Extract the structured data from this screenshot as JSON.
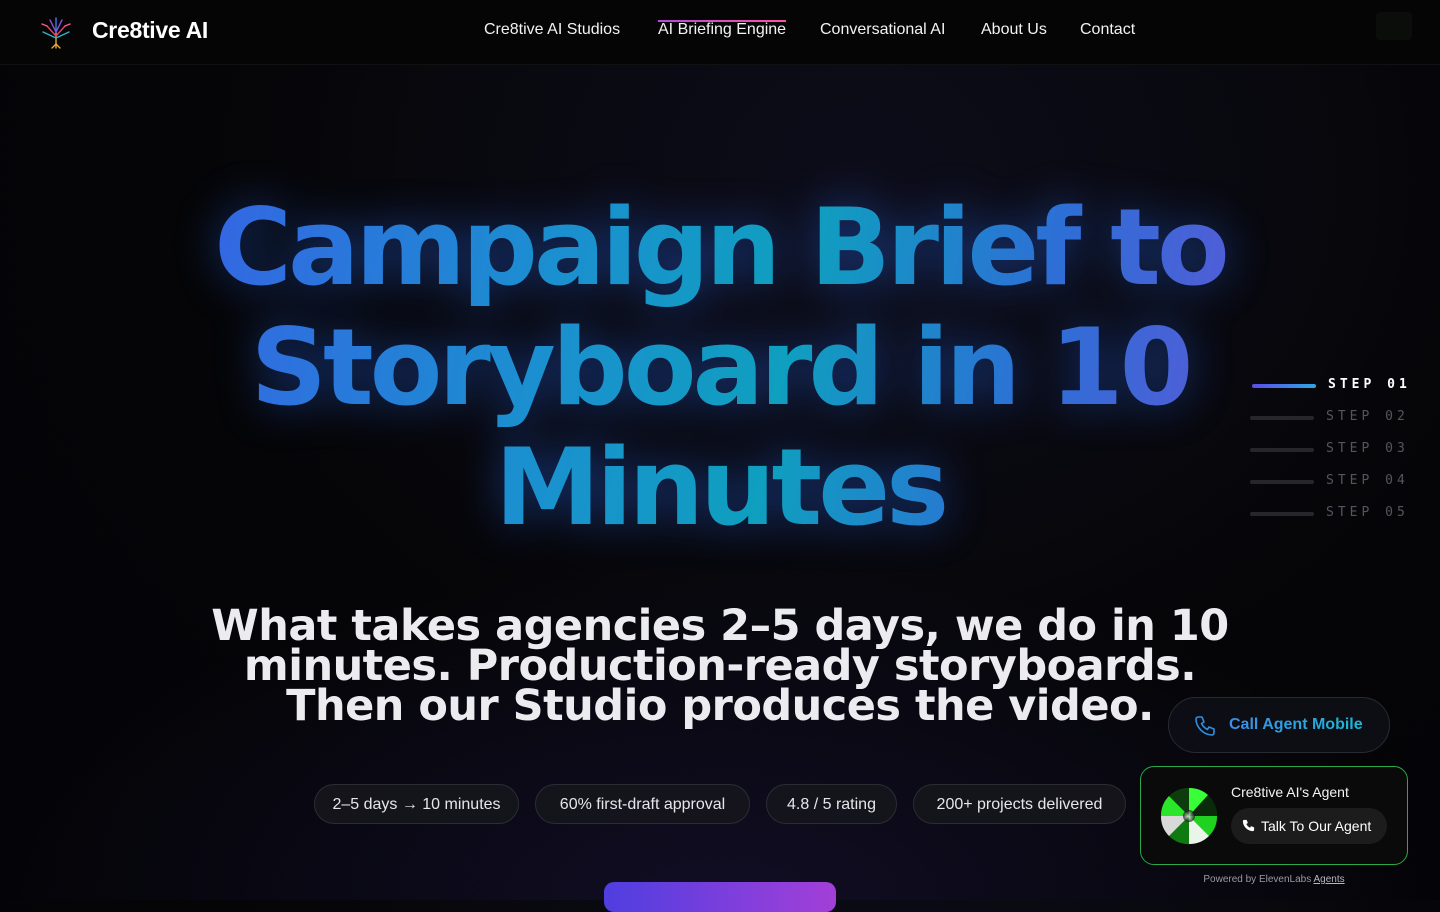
{
  "brand": {
    "name": "Cre8tive AI",
    "logo_icon": "tree-logo-icon"
  },
  "nav": {
    "items": [
      {
        "label": "Cre8tive AI Studios",
        "active": false
      },
      {
        "label": "AI Briefing Engine",
        "active": true
      },
      {
        "label": "Conversational AI",
        "active": false
      },
      {
        "label": "About Us",
        "active": false
      },
      {
        "label": "Contact",
        "active": false
      }
    ],
    "menu_icon": "menu-icon"
  },
  "hero": {
    "title": "Campaign Brief to Storyboard in 10 Minutes",
    "subtitle": "What takes agencies 2–5 days, we do in 10 minutes. Production-ready storyboards. Then our Studio produces the video.",
    "stats": [
      "2–5 days → 10 minutes",
      "60% first-draft approval",
      "4.8 / 5 rating",
      "200+ projects delivered"
    ]
  },
  "steps": [
    {
      "label": "STEP 01",
      "active": true
    },
    {
      "label": "STEP 02",
      "active": false
    },
    {
      "label": "STEP 03",
      "active": false
    },
    {
      "label": "STEP 04",
      "active": false
    },
    {
      "label": "STEP 05",
      "active": false
    }
  ],
  "call_agent": {
    "label": "Call Agent Mobile",
    "icon": "phone-icon"
  },
  "agent_widget": {
    "name": "Cre8tive AI's Agent",
    "talk_label": "Talk To Our Agent",
    "powered_prefix": "Powered by ElevenLabs",
    "powered_link": "Agents"
  },
  "colors": {
    "accent_blue": "#1b8fd0",
    "accent_purple": "#6b50d8",
    "nav_active": "#ff4fa3",
    "agent_border": "#2aa84a"
  }
}
